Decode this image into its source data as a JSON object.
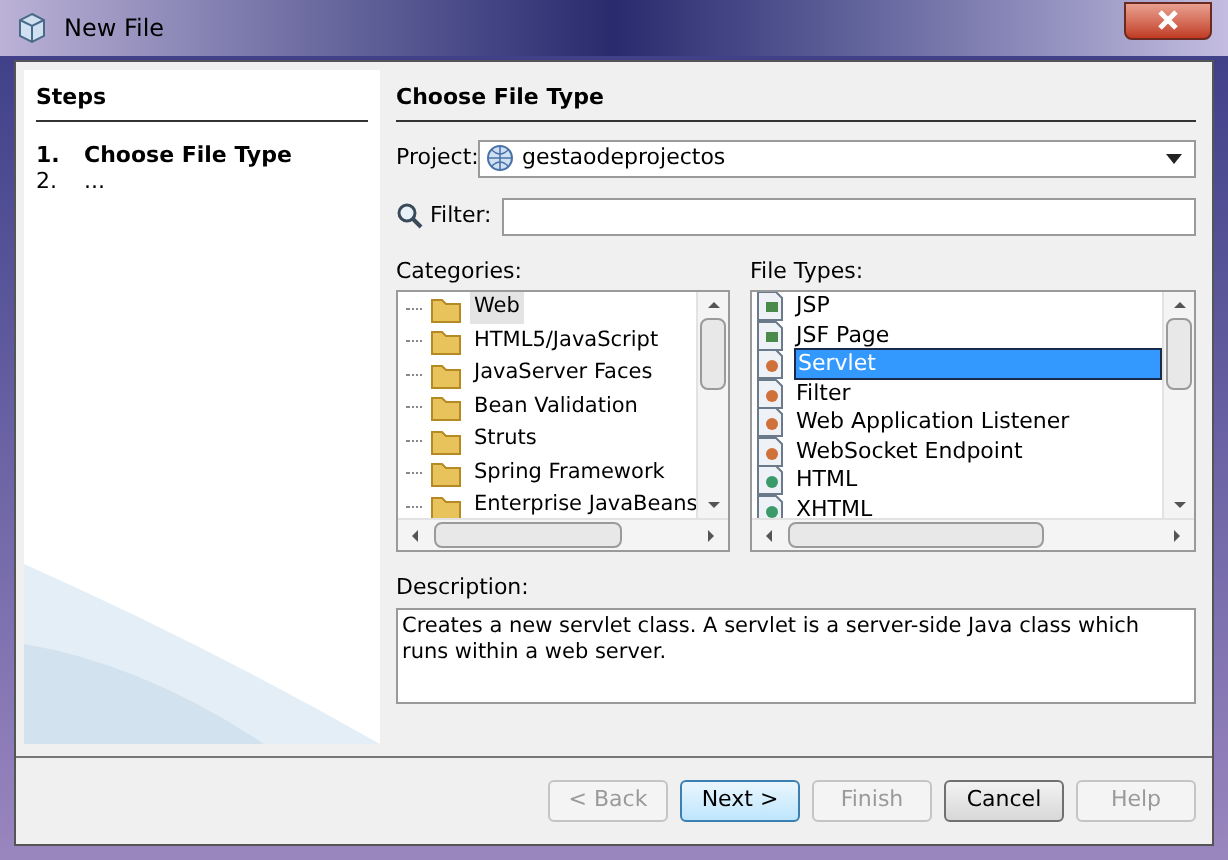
{
  "window": {
    "title": "New File"
  },
  "steps": {
    "title": "Steps",
    "items": [
      {
        "number": "1.",
        "label": "Choose File Type",
        "selected": true
      },
      {
        "number": "2.",
        "label": "...",
        "selected": false
      }
    ]
  },
  "panel": {
    "title": "Choose File Type",
    "project": {
      "label": "Project:",
      "value": "gestaodeprojectos"
    },
    "filter": {
      "label": "Filter:"
    },
    "categories": {
      "label": "Categories:",
      "items": [
        {
          "label": "Web",
          "selected": true
        },
        {
          "label": "HTML5/JavaScript",
          "selected": false
        },
        {
          "label": "JavaServer Faces",
          "selected": false
        },
        {
          "label": "Bean Validation",
          "selected": false
        },
        {
          "label": "Struts",
          "selected": false
        },
        {
          "label": "Spring Framework",
          "selected": false
        },
        {
          "label": "Enterprise JavaBeans",
          "selected": false
        }
      ]
    },
    "file_types": {
      "label": "File Types:",
      "items": [
        {
          "label": "JSP",
          "kind": "page",
          "selected": false
        },
        {
          "label": "JSF Page",
          "kind": "page",
          "selected": false
        },
        {
          "label": "Servlet",
          "kind": "class",
          "selected": true
        },
        {
          "label": "Filter",
          "kind": "class",
          "selected": false
        },
        {
          "label": "Web Application Listener",
          "kind": "class",
          "selected": false
        },
        {
          "label": "WebSocket Endpoint",
          "kind": "class",
          "selected": false
        },
        {
          "label": "HTML",
          "kind": "web",
          "selected": false
        },
        {
          "label": "XHTML",
          "kind": "web",
          "selected": false
        }
      ]
    },
    "description": {
      "label": "Description:",
      "text": "Creates a new servlet class. A servlet is a server-side Java class which runs within a web server."
    }
  },
  "buttons": [
    {
      "label": "< Back",
      "disabled": true,
      "default": false
    },
    {
      "label": "Next >",
      "disabled": false,
      "default": true
    },
    {
      "label": "Finish",
      "disabled": true,
      "default": false
    },
    {
      "label": "Cancel",
      "disabled": false,
      "default": false
    },
    {
      "label": "Help",
      "disabled": true,
      "default": false
    }
  ]
}
